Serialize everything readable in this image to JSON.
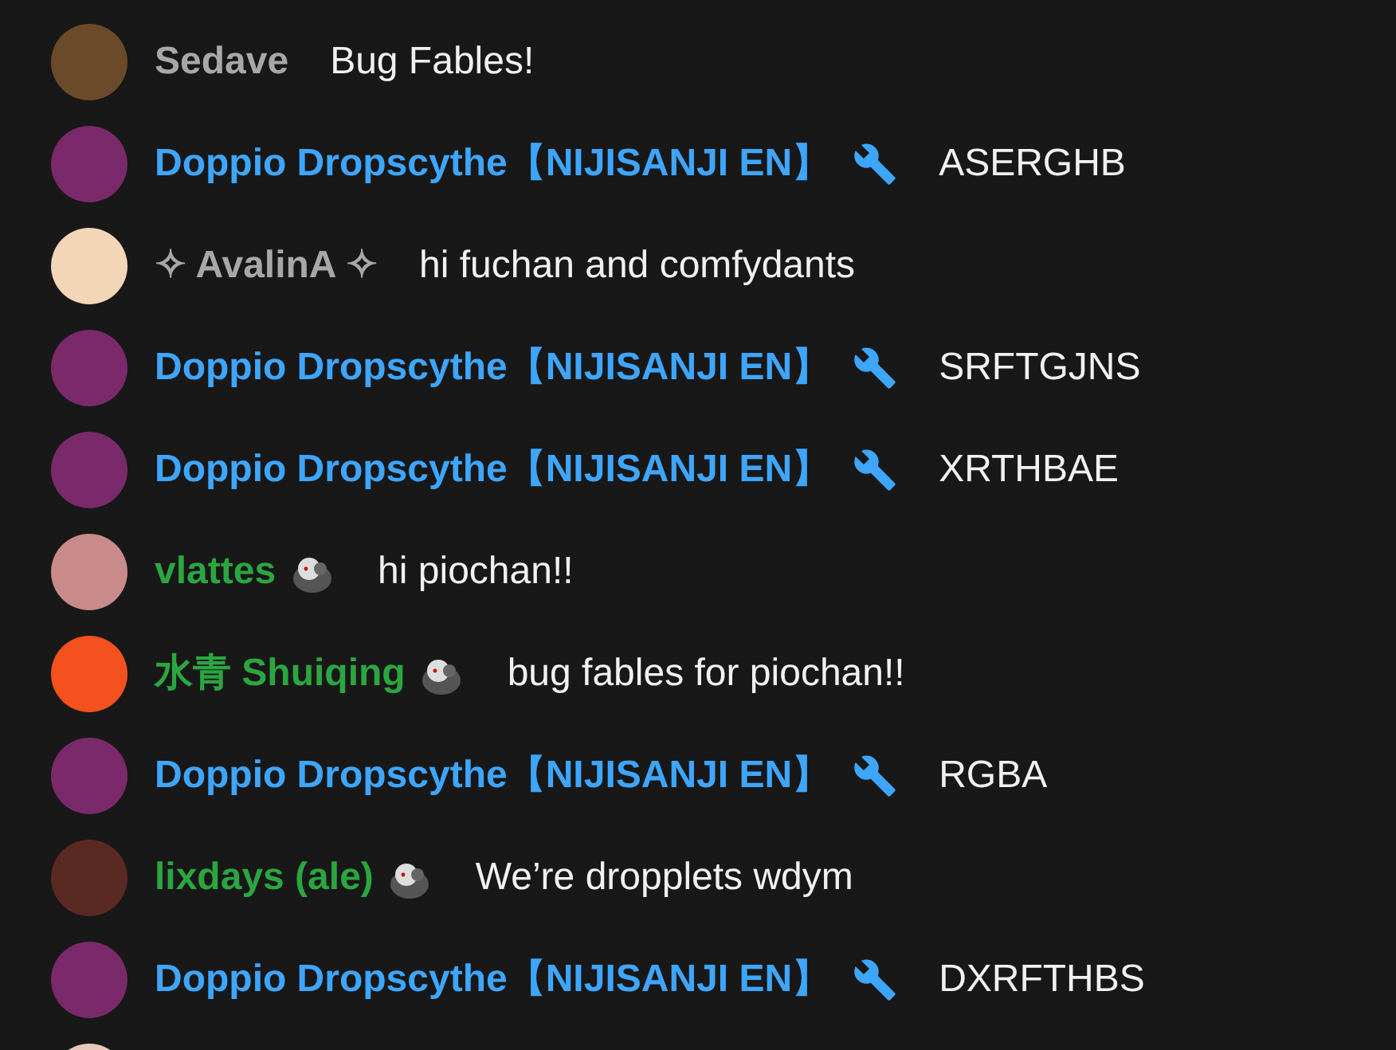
{
  "messages": [
    {
      "author": "Sedave",
      "kind": "viewer",
      "member_badge": false,
      "color": "#6b4a2a",
      "text": "Bug Fables!"
    },
    {
      "author": "Doppio Dropscythe【NIJISANJI EN】",
      "kind": "moderator",
      "member_badge": false,
      "color": "#7a2a6a",
      "text": "ASERGHB"
    },
    {
      "author": "✧ AvalinA ✧",
      "kind": "viewer",
      "member_badge": false,
      "color": "#f3d6b8",
      "text": "hi fuchan and comfydants"
    },
    {
      "author": "Doppio Dropscythe【NIJISANJI EN】",
      "kind": "moderator",
      "member_badge": false,
      "color": "#7a2a6a",
      "text": "SRFTGJNS"
    },
    {
      "author": "Doppio Dropscythe【NIJISANJI EN】",
      "kind": "moderator",
      "member_badge": false,
      "color": "#7a2a6a",
      "text": "XRTHBAE"
    },
    {
      "author": "vlattes",
      "kind": "member",
      "member_badge": true,
      "color": "#c98a8a",
      "text": "hi piochan!!"
    },
    {
      "author": "水青 Shuiqing",
      "kind": "member",
      "member_badge": true,
      "color": "#f4511e",
      "text": "bug fables for piochan!!"
    },
    {
      "author": "Doppio Dropscythe【NIJISANJI EN】",
      "kind": "moderator",
      "member_badge": false,
      "color": "#7a2a6a",
      "text": "RGBA"
    },
    {
      "author": "lixdays (ale)",
      "kind": "member",
      "member_badge": true,
      "color": "#5a2a22",
      "text": "We’re dropplets wdym"
    },
    {
      "author": "Doppio Dropscythe【NIJISANJI EN】",
      "kind": "moderator",
      "member_badge": false,
      "color": "#7a2a6a",
      "text": "DXRFTHBS"
    }
  ]
}
